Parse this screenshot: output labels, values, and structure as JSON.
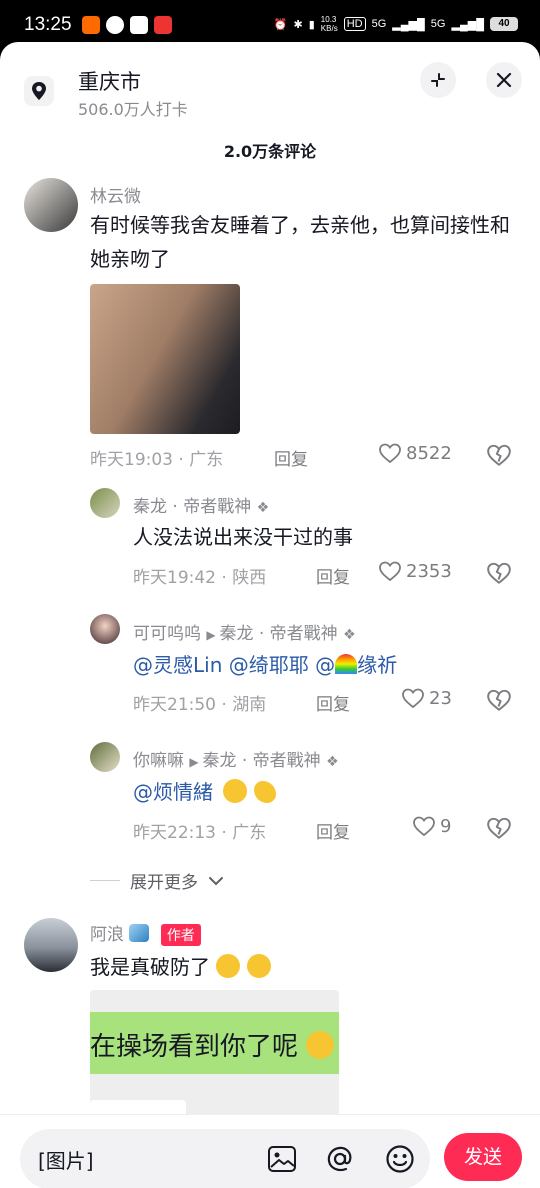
{
  "status_bar": {
    "time": "13:25",
    "net_speed": "10.3\nKB/s",
    "signal_1": "5G",
    "signal_2": "5G",
    "hd": "HD",
    "battery": "40"
  },
  "header": {
    "city": "重庆市",
    "checkin_count": "506.0万人打卡",
    "comment_count_title": "2.0万条评论"
  },
  "comments": [
    {
      "username": "林云微",
      "text": "有时候等我舍友睡着了，去亲他，也算间接性和她亲吻了",
      "time": "昨天19:03",
      "region": "广东",
      "reply_label": "回复",
      "likes": "8522"
    }
  ],
  "replies": [
    {
      "username": "秦龙 · 帝者戰神",
      "text": "人没法说出来没干过的事",
      "time": "昨天19:42",
      "region": "陕西",
      "reply_label": "回复",
      "likes": "2353"
    },
    {
      "username": "可可呜呜",
      "reply_to": "秦龙 · 帝者戰神",
      "mentions": [
        "@灵感Lin",
        "@绮耶耶",
        "@",
        "缘祈"
      ],
      "time": "昨天21:50",
      "region": "湖南",
      "reply_label": "回复",
      "likes": "23"
    },
    {
      "username": "你嘛嘛",
      "reply_to": "秦龙 · 帝者戰神",
      "mention": "@烦情緒",
      "time": "昨天22:13",
      "region": "广东",
      "reply_label": "回复",
      "likes": "9"
    }
  ],
  "expand_more": "展开更多",
  "comment2": {
    "username": "阿浪",
    "author_tag": "作者",
    "text": "我是真破防了",
    "image_caption": "在操场看到你了呢"
  },
  "input": {
    "placeholder_value": "[图片]",
    "send_label": "发送"
  },
  "icons": {
    "location": "location-pin-icon",
    "minimize": "minimize-icon",
    "close": "close-icon",
    "heart": "heart-icon",
    "dislike": "broken-heart-icon",
    "image": "image-icon",
    "at": "at-icon",
    "emoji": "emoji-icon"
  },
  "colors": {
    "accent": "#fe2c55",
    "mention": "#2b5aa8",
    "secondary_text": "#8a8b91"
  }
}
